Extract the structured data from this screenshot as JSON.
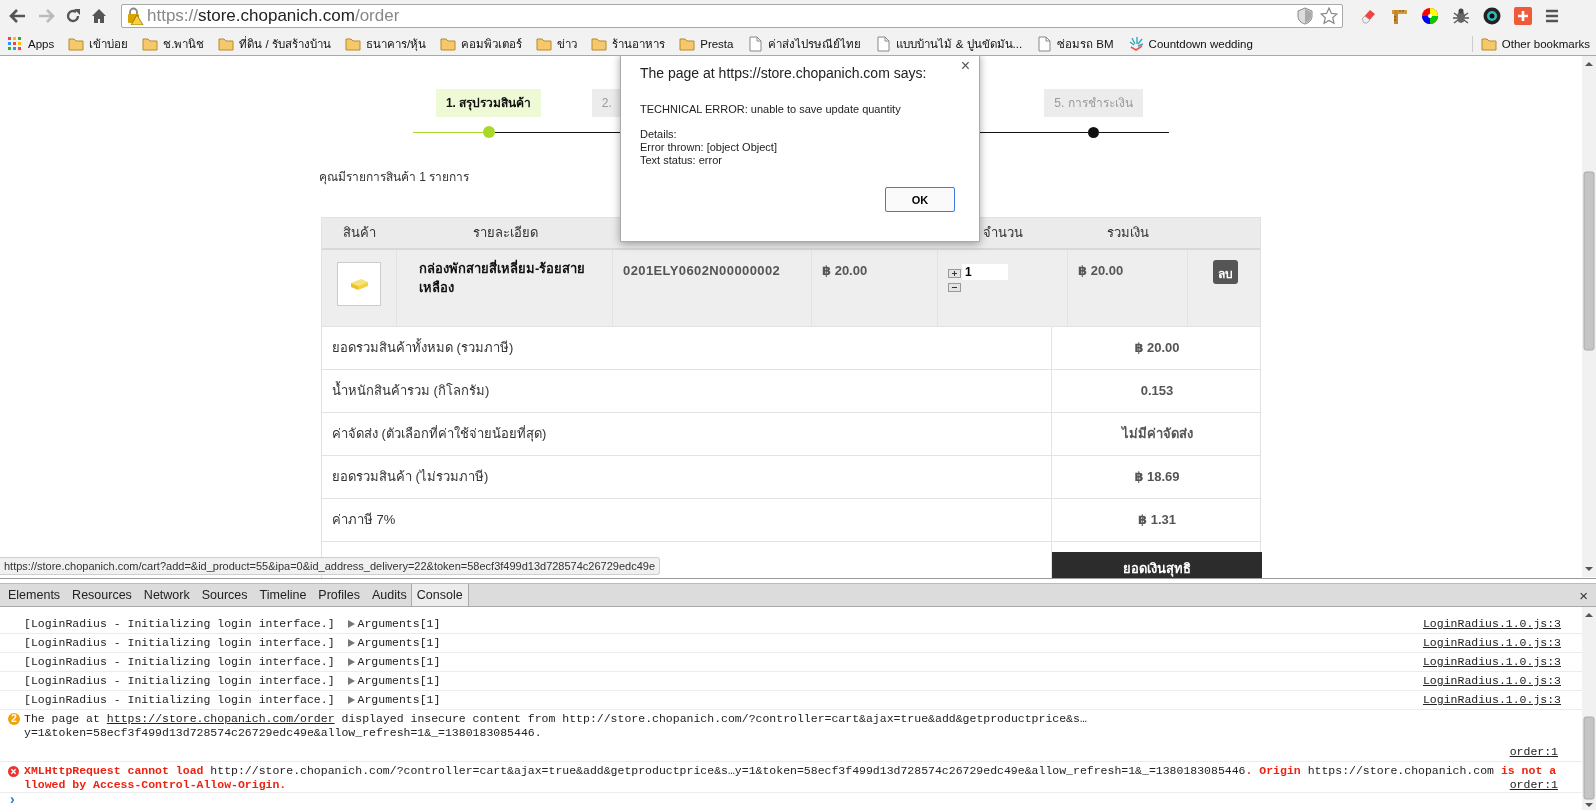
{
  "browser": {
    "url": {
      "scheme": "https://",
      "host": "store.chopanich.com",
      "path": "/order"
    },
    "bookmarks": [
      {
        "kind": "apps",
        "label": "Apps"
      },
      {
        "kind": "folder",
        "label": "เข้าบ่อย"
      },
      {
        "kind": "folder",
        "label": "ช.พานิช"
      },
      {
        "kind": "folder",
        "label": "ที่ดิน / รับสร้างบ้าน"
      },
      {
        "kind": "folder",
        "label": "ธนาคาร/หุ้น"
      },
      {
        "kind": "folder",
        "label": "คอมพิวเตอร์"
      },
      {
        "kind": "folder",
        "label": "ข่าว"
      },
      {
        "kind": "folder",
        "label": "ร้านอาหาร"
      },
      {
        "kind": "folder",
        "label": "Presta"
      },
      {
        "kind": "page",
        "label": "ค่าส่งไปรษณีย์ไทย"
      },
      {
        "kind": "page",
        "label": "แบบบ้านไม้ & ปูนขัดมัน..."
      },
      {
        "kind": "page",
        "label": "ซ่อมรถ BM"
      },
      {
        "kind": "countdown",
        "label": "Countdown wedding"
      }
    ],
    "other_bookmarks": "Other bookmarks"
  },
  "page": {
    "steps": [
      {
        "label": "1. สรุปรวมสินค้า",
        "selected": true
      },
      {
        "label": "2.",
        "selected": false
      },
      {
        "label": "5. การชำระเงิน",
        "selected": false
      }
    ],
    "item_count_text": "คุณมีรายการสินค้า 1 รายการ",
    "table": {
      "columns": [
        "สินค้า",
        "รายละเอียด",
        "จำนวน",
        "รวมเงิน"
      ],
      "rows": [
        {
          "name": "กล่องพักสายสี่เหลี่ยม-ร้อยสายเหลือง",
          "code": "0201ELY0602N00000002",
          "price": "฿ 20.00",
          "quantity": "1",
          "total": "฿ 20.00",
          "delete": "ลบ"
        }
      ],
      "summary": [
        {
          "kind": "line",
          "label": "ยอดรวมสินค้าทั้งหมด (รวมภาษี)",
          "value": "฿ 20.00"
        },
        {
          "kind": "line",
          "label": "น้ำหนักสินค้ารวม (กิโลกรัม)",
          "value": "0.153"
        },
        {
          "kind": "line",
          "label": "ค่าจัดส่ง (ตัวเลือกที่ค่าใช้จ่ายน้อยที่สุด)",
          "value": "ไม่มีค่าจัดส่ง"
        },
        {
          "kind": "line",
          "label": "ยอดรวมสินค้า (ไม่รวมภาษี)",
          "value": "฿ 18.69"
        },
        {
          "kind": "line",
          "label": "ค่าภาษี 7%",
          "value": "฿ 1.31"
        },
        {
          "kind": "net_heading",
          "value": "ยอดเงินสุทธิ"
        }
      ]
    },
    "status_url": "https://store.chopanich.com/cart?add=&id_product=55&ipa=0&id_address_delivery=22&token=58ecf3f499d13d728574c26729edc49e"
  },
  "dialog": {
    "title": "The page at https://store.chopanich.com says:",
    "close": "×",
    "message": "TECHNICAL ERROR: unable to save update quantity",
    "details": [
      "Details:",
      "Error thrown: [object Object]",
      "Text status: error"
    ],
    "ok": "OK"
  },
  "devtools": {
    "tabs": [
      {
        "label": "Elements",
        "selected": false
      },
      {
        "label": "Resources",
        "selected": false
      },
      {
        "label": "Network",
        "selected": false
      },
      {
        "label": "Sources",
        "selected": false
      },
      {
        "label": "Timeline",
        "selected": false
      },
      {
        "label": "Profiles",
        "selected": false
      },
      {
        "label": "Audits",
        "selected": false
      },
      {
        "label": "Console",
        "selected": true
      }
    ],
    "close": "×",
    "console": [
      {
        "kind": "log",
        "text": "[LoginRadius - Initializing login interface.]",
        "args": "Arguments[1]",
        "source": "LoginRadius.1.0.js:3"
      },
      {
        "kind": "log",
        "text": "[LoginRadius - Initializing login interface.]",
        "args": "Arguments[1]",
        "source": "LoginRadius.1.0.js:3"
      },
      {
        "kind": "log",
        "text": "[LoginRadius - Initializing login interface.]",
        "args": "Arguments[1]",
        "source": "LoginRadius.1.0.js:3"
      },
      {
        "kind": "log",
        "text": "[LoginRadius - Initializing login interface.]",
        "args": "Arguments[1]",
        "source": "LoginRadius.1.0.js:3"
      },
      {
        "kind": "log",
        "text": "[LoginRadius - Initializing login interface.]",
        "args": "Arguments[1]",
        "source": "LoginRadius.1.0.js:3"
      },
      {
        "kind": "insecure",
        "count": "2",
        "before_link": "The page at ",
        "link": "https://store.chopanich.com/order",
        "after_link": " displayed insecure content from http://store.chopanich.com/?controller=cart&ajax=true&add&getproductprice&s…",
        "continuation": "y=1&token=58ecf3f499d13d728574c26729edc49e&allow_refresh=1&_=1380183085446.",
        "source": "order:1"
      },
      {
        "kind": "error",
        "segments": [
          {
            "kind": "error",
            "text": "XMLHttpRequest cannot load "
          },
          {
            "kind": "plain",
            "text": "http://store.chopanich.com/?controller=cart&ajax=true&add&getproductprice&s…y=1&token=58ecf3f499d13d728574c26729edc49e&allow_refresh=1&_=1380183085446"
          },
          {
            "kind": "error",
            "text": ". Origin "
          },
          {
            "kind": "plain",
            "text": "https://store.chopanich.com"
          },
          {
            "kind": "error",
            "text": " is not allowed by Access-Control-Allow-Origin."
          }
        ],
        "source": "order:1"
      }
    ],
    "prompt": "›"
  }
}
